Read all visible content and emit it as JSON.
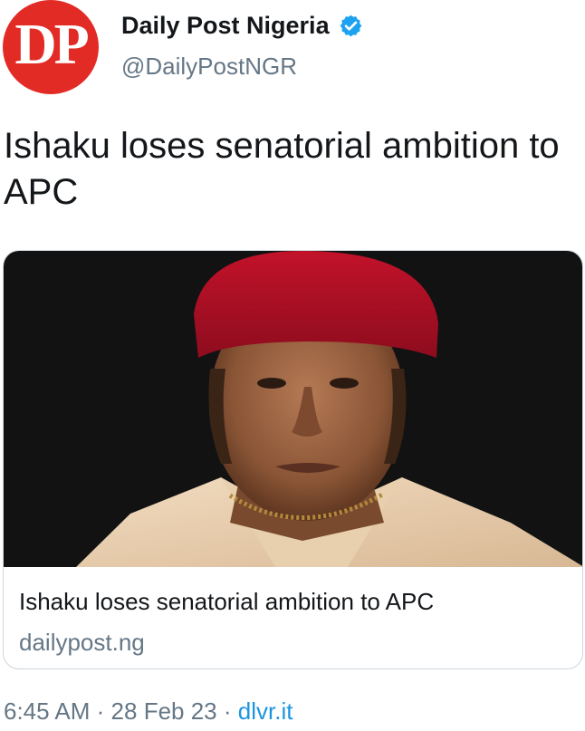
{
  "account": {
    "avatar_text": "DP",
    "display_name": "Daily Post Nigeria",
    "handle": "@DailyPostNGR",
    "verified": true
  },
  "tweet": {
    "text": "Ishaku loses senatorial ambition to APC"
  },
  "card": {
    "image": "portrait-photo",
    "title": "Ishaku loses senatorial ambition to APC",
    "domain": "dailypost.ng"
  },
  "meta": {
    "time": "6:45 AM",
    "separator": "·",
    "date": "28 Feb 23",
    "source": "dlvr.it"
  },
  "colors": {
    "brand_red": "#e32b26",
    "verified_blue": "#1da1f2",
    "link_blue": "#1b95e0",
    "secondary_text": "#657786"
  }
}
